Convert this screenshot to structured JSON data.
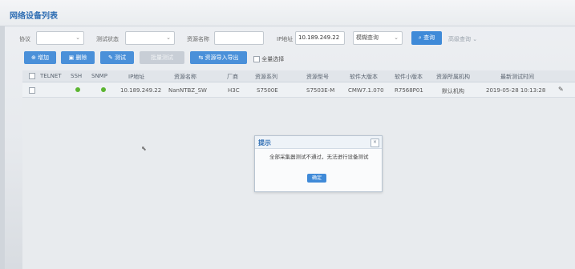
{
  "page_title": "网络设备列表",
  "filters": {
    "protocol_label": "协议",
    "protocol_value": "",
    "test_status_label": "测试状态",
    "test_status_value": "",
    "resource_name_label": "资源名称",
    "resource_name_value": "",
    "ip_label": "IP地址",
    "ip_value": "10.189.249.22",
    "match_mode_value": "模糊查询",
    "query_button": "查询",
    "advanced_link": "高级查询"
  },
  "toolbar": {
    "add": "增加",
    "delete": "删除",
    "test": "测试",
    "batch_test": "批量测试",
    "import_export": "资源导入导出",
    "select_all": "全量选择"
  },
  "table": {
    "headers": [
      "TELNET",
      "SSH",
      "SNMP",
      "IP地址",
      "资源名称",
      "厂商",
      "资源系列",
      "资源型号",
      "软件大版本",
      "软件小版本",
      "资源所属机构",
      "最新测试时间"
    ],
    "rows": [
      {
        "telnet": "",
        "ssh": "ok",
        "snmp": "ok",
        "ip": "10.189.249.22",
        "name": "NanNTBZ_SW",
        "vendor": "H3C",
        "series": "S7500E",
        "model": "S7503E-M",
        "sw_major": "CMW7.1.070",
        "sw_minor": "R7568P01",
        "org": "默认机构",
        "last_test": "2019-05-28 10:13:28"
      }
    ]
  },
  "dialog": {
    "title": "提示",
    "close": "×",
    "message": "全部采集器测试不通过，无法进行设备测试",
    "ok_button": "确定"
  },
  "colors": {
    "accent": "#3f8ad8",
    "status_ok": "#5cb531"
  },
  "icons": {
    "dropdown": "chevron-down-icon",
    "search": "search-icon",
    "add": "plus-icon",
    "delete": "trash-icon",
    "test": "pencil-icon",
    "edit": "pencil-icon",
    "close": "close-icon"
  }
}
